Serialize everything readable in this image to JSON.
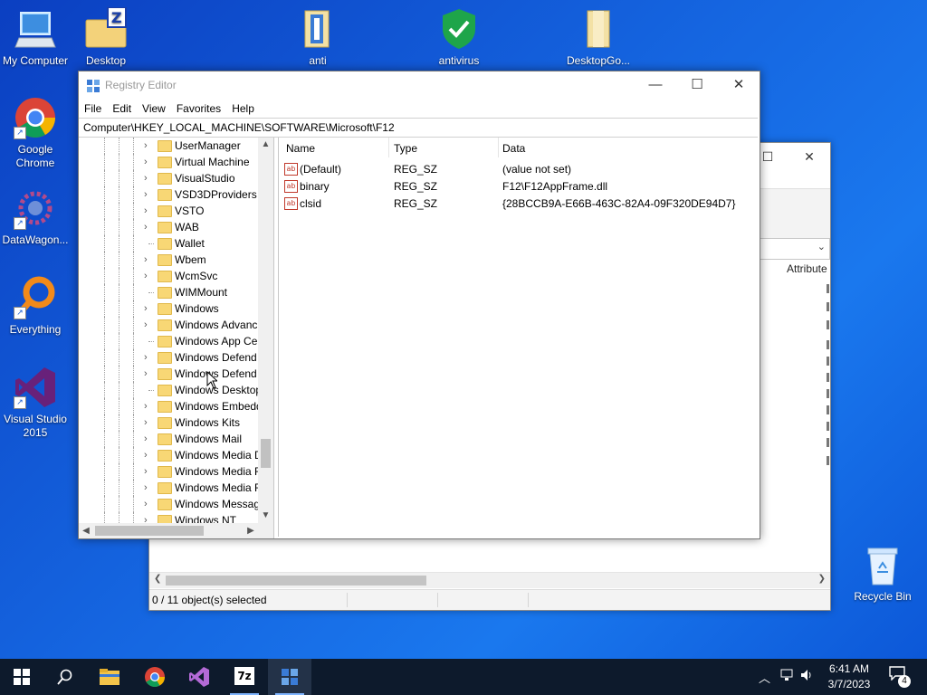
{
  "desktop": {
    "icons": [
      {
        "label": "My Computer"
      },
      {
        "label": "Desktop"
      },
      {
        "label": "anti"
      },
      {
        "label": "antivirus"
      },
      {
        "label": "DesktopGo..."
      },
      {
        "label": "Google Chrome"
      },
      {
        "label": "DataWagon..."
      },
      {
        "label": "Everything"
      },
      {
        "label": "Visual Studio 2015"
      }
    ],
    "recycle_bin": {
      "label": "Recycle Bin"
    }
  },
  "back_window": {
    "column_header": "Attribute",
    "status": "0 / 11 object(s) selected"
  },
  "regedit": {
    "title": "Registry Editor",
    "controls": {
      "minimize": "—",
      "maximize": "☐",
      "close": "✕"
    },
    "menu": [
      "File",
      "Edit",
      "View",
      "Favorites",
      "Help"
    ],
    "address": "Computer\\HKEY_LOCAL_MACHINE\\SOFTWARE\\Microsoft\\F12",
    "tree": [
      {
        "label": "UserManager",
        "expand": true
      },
      {
        "label": "Virtual Machine",
        "expand": true
      },
      {
        "label": "VisualStudio",
        "expand": true
      },
      {
        "label": "VSD3DProviders",
        "expand": true
      },
      {
        "label": "VSTO",
        "expand": true
      },
      {
        "label": "WAB",
        "expand": true
      },
      {
        "label": "Wallet",
        "expand": false
      },
      {
        "label": "Wbem",
        "expand": true
      },
      {
        "label": "WcmSvc",
        "expand": true
      },
      {
        "label": "WIMMount",
        "expand": false
      },
      {
        "label": "Windows",
        "expand": true
      },
      {
        "label": "Windows Advanc",
        "expand": true
      },
      {
        "label": "Windows App Ce",
        "expand": false
      },
      {
        "label": "Windows Defend",
        "expand": true
      },
      {
        "label": "Windows Defend",
        "expand": true
      },
      {
        "label": "Windows Desktop",
        "expand": false
      },
      {
        "label": "Windows Embedd",
        "expand": true
      },
      {
        "label": "Windows Kits",
        "expand": true
      },
      {
        "label": "Windows Mail",
        "expand": true
      },
      {
        "label": "Windows Media D",
        "expand": true
      },
      {
        "label": "Windows Media F",
        "expand": true
      },
      {
        "label": "Windows Media F",
        "expand": true
      },
      {
        "label": "Windows Messag",
        "expand": true
      },
      {
        "label": "Windows NT",
        "expand": true
      }
    ],
    "columns": {
      "name": "Name",
      "type": "Type",
      "data": "Data"
    },
    "values": [
      {
        "name": "(Default)",
        "type": "REG_SZ",
        "data": "(value not set)"
      },
      {
        "name": "binary",
        "type": "REG_SZ",
        "data": "F12\\F12AppFrame.dll"
      },
      {
        "name": "clsid",
        "type": "REG_SZ",
        "data": "{28BCCB9A-E66B-463C-82A4-09F320DE94D7}"
      }
    ]
  },
  "taskbar": {
    "time": "6:41 AM",
    "date": "3/7/2023",
    "notification_count": "4",
    "apps": [
      "start",
      "search",
      "file-explorer",
      "chrome",
      "visual-studio",
      "7zip",
      "registry-editor"
    ]
  }
}
